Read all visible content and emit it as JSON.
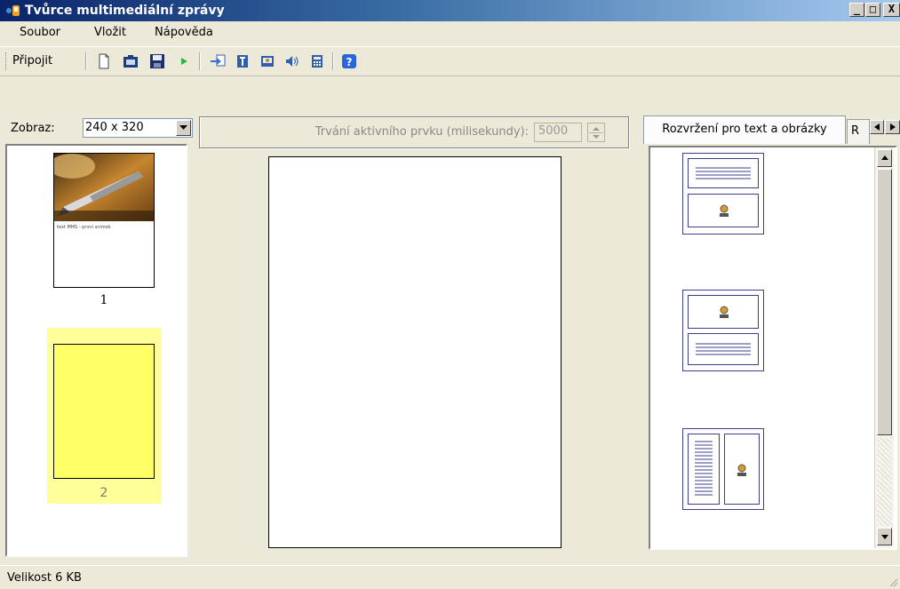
{
  "window": {
    "title": "Tvůrce multimediální zprávy",
    "controls": {
      "minimize": "_",
      "maximize": "□",
      "close": "X"
    }
  },
  "menu": [
    "Soubor",
    "Vložit",
    "Nápověda"
  ],
  "toolbar": {
    "connect_label": "Připojit",
    "icons": [
      "new-icon",
      "open-icon",
      "save-icon",
      "play-icon",
      "import-icon",
      "insert-text-icon",
      "insert-image-icon",
      "insert-sound-icon",
      "calculator-icon",
      "help-icon"
    ]
  },
  "view": {
    "label": "Zobraz:",
    "value": "240 x 320"
  },
  "slides": [
    {
      "number": "1",
      "caption": "text MMS - první snímek",
      "selected": false
    },
    {
      "number": "2",
      "selected": true
    }
  ],
  "duration": {
    "label": "Trvání aktivního prvku (milisekundy):",
    "value": "5000"
  },
  "layout_tabs": {
    "active": "Rozvržení pro text a obrázky",
    "next_partial": "R"
  },
  "layouts": [
    "text-top-image-bottom",
    "image-top-text-bottom",
    "text-left-image-right"
  ],
  "status": {
    "text": "Velikost 6 KB"
  },
  "colors": {
    "title_bar_start": "#0a246a",
    "title_bar_end": "#a6caf0",
    "selected_slide": "#ffff66",
    "layout_border": "#3b3f8c"
  }
}
